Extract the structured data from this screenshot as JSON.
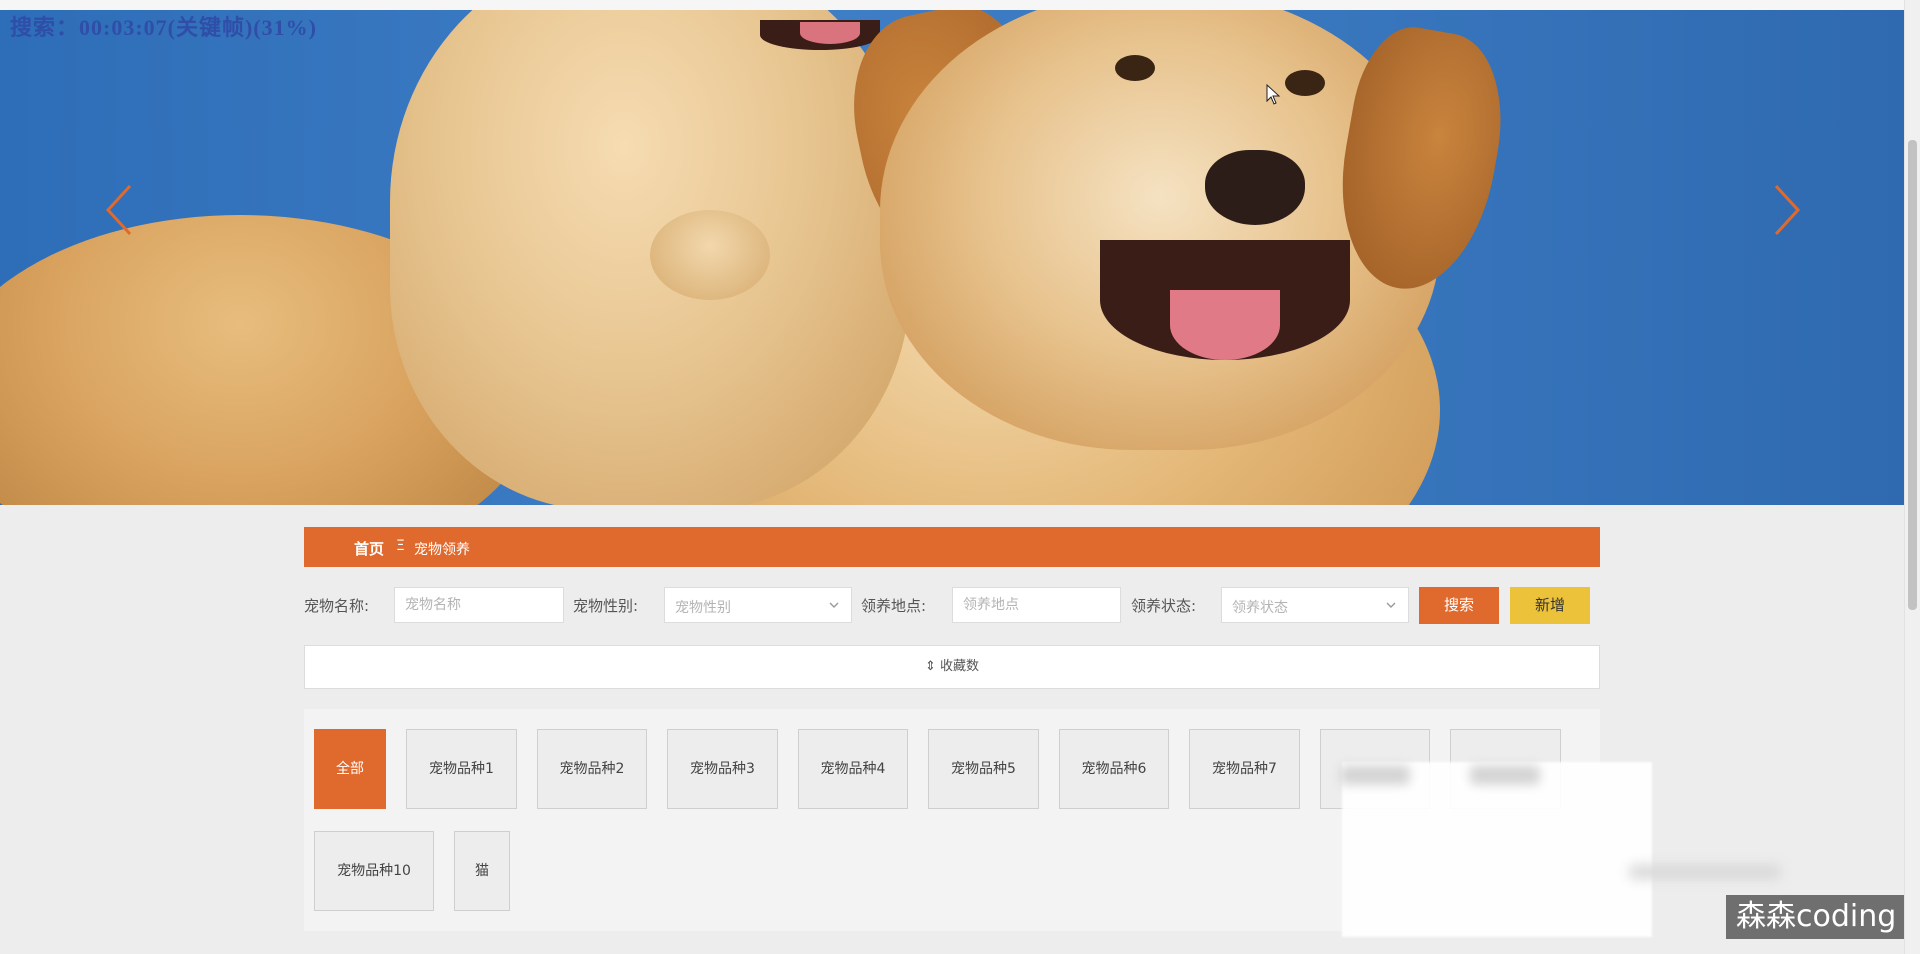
{
  "overlay": {
    "text": "搜索：00:03:07(关键帧)(31%)"
  },
  "banner": {
    "prev_icon": "chevron-left-icon",
    "next_icon": "chevron-right-icon"
  },
  "breadcrumb": {
    "home": "首页",
    "separator": "Ξ",
    "current": "宠物领养"
  },
  "search": {
    "name_label": "宠物名称:",
    "name_placeholder": "宠物名称",
    "gender_label": "宠物性别:",
    "gender_placeholder": "宠物性别",
    "location_label": "领养地点:",
    "location_placeholder": "领养地点",
    "status_label": "领养状态:",
    "status_placeholder": "领养状态",
    "search_button": "搜索",
    "add_button": "新增"
  },
  "sort": {
    "label": "收藏数",
    "icon": "sort-icon"
  },
  "categories": {
    "items": [
      "全部",
      "宠物品种1",
      "宠物品种2",
      "宠物品种3",
      "宠物品种4",
      "宠物品种5",
      "宠物品种6",
      "宠物品种7",
      "宠物品种10",
      "猫"
    ]
  },
  "watermark": {
    "text": "森森coding"
  },
  "colors": {
    "accent": "#e06a2d",
    "add_button": "#ecc23a",
    "banner_blue": "#3876bd"
  }
}
